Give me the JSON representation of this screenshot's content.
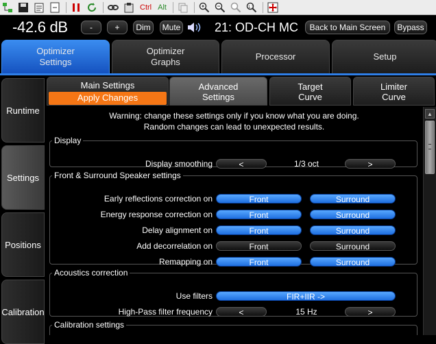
{
  "toolbar": {
    "ctrl_label": "Ctrl",
    "alt_label": "Alt"
  },
  "status": {
    "volume": "-42.6 dB",
    "minus": "-",
    "plus": "+",
    "dim": "Dim",
    "mute": "Mute",
    "preset": "21: OD-CH MC",
    "back": "Back to Main Screen",
    "bypass": "Bypass"
  },
  "main_tabs": [
    {
      "line1": "Optimizer",
      "line2": "Settings"
    },
    {
      "line1": "Optimizer",
      "line2": "Graphs"
    },
    {
      "line1": "Processor"
    },
    {
      "line1": "Setup"
    }
  ],
  "side_tabs": [
    "Runtime",
    "Settings",
    "Positions",
    "Calibration"
  ],
  "sub_tabs": {
    "main": "Main Settings",
    "apply": "Apply Changes",
    "advanced1": "Advanced",
    "advanced2": "Settings",
    "target1": "Target",
    "target2": "Curve",
    "limiter1": "Limiter",
    "limiter2": "Curve"
  },
  "warning": {
    "line1": "Warning: change these settings only if you know what you are doing.",
    "line2": "Random changes can lead to unexpected results."
  },
  "display": {
    "title": "Display",
    "smoothing_label": "Display smoothing",
    "left": "<",
    "value": "1/3 oct",
    "right": ">"
  },
  "speaker": {
    "title": "Front & Surround Speaker settings",
    "front": "Front",
    "surround": "Surround",
    "rows": [
      {
        "label": "Early reflections correction on",
        "front_on": true,
        "surround_on": true
      },
      {
        "label": "Energy response correction on",
        "front_on": true,
        "surround_on": true
      },
      {
        "label": "Delay alignment on",
        "front_on": true,
        "surround_on": true
      },
      {
        "label": "Add decorrelation on",
        "front_on": false,
        "surround_on": false
      },
      {
        "label": "Remapping on",
        "front_on": true,
        "surround_on": true
      }
    ]
  },
  "acoustics": {
    "title": "Acoustics correction",
    "filters_label": "Use filters",
    "filters_value": "FIR+IIR ->",
    "hp_label": "High-Pass filter frequency",
    "hp_left": "<",
    "hp_value": "15 Hz",
    "hp_right": ">"
  },
  "calibration": {
    "title": "Calibration settings"
  },
  "colors": {
    "accent_blue": "#2f7fe8",
    "apply_orange": "#f57615"
  }
}
